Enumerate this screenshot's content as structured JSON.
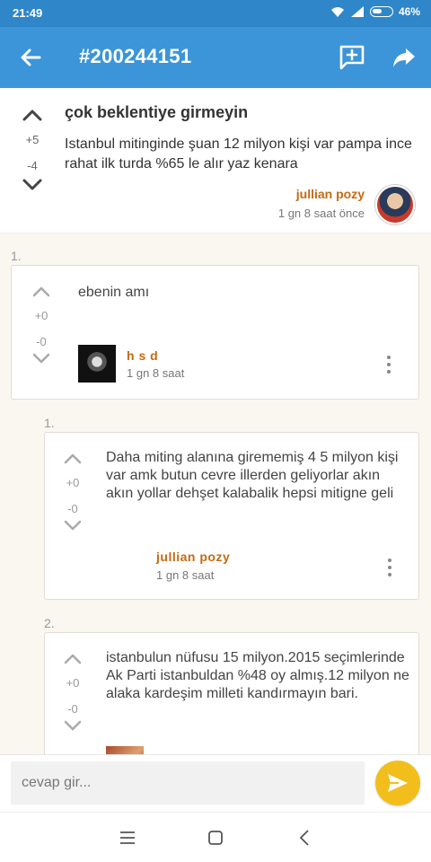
{
  "status": {
    "time": "21:49",
    "battery": "46%"
  },
  "appbar": {
    "title": "#200244151"
  },
  "entry": {
    "title": "çok beklentiye girmeyin",
    "body": "Istanbul mitinginde şuan 12 milyon kişi var pampa ince rahat ilk turda %65 le alır yaz kenara",
    "up": "+5",
    "down": "-4",
    "author": "jullian pozy",
    "meta": "1 gn 8 saat  önce"
  },
  "comments": [
    {
      "index": "1.",
      "up": "+0",
      "down": "-0",
      "text": "ebenin amı",
      "author": "h s d",
      "time": "1 gn 8 saat"
    },
    {
      "index": "1.",
      "up": "+0",
      "down": "-0",
      "text": "Daha miting alanına girememiş 4 5 milyon kişi var amk butun cevre illerden geliyorlar akın akın yollar dehşet kalabalik hepsi mitigne geli",
      "author": "jullian pozy",
      "time": "1 gn 8 saat"
    },
    {
      "index": "2.",
      "up": "+0",
      "down": "-0",
      "text": "istanbulun nüfusu 15 milyon.2015 seçimlerinde Ak Parti istanbuldan %48 oy almış.12 milyon ne alaka kardeşim milleti kandırmayın bari."
    }
  ],
  "reply": {
    "placeholder": "cevap gir..."
  },
  "colors": {
    "appbar": "#3b95d8",
    "statusbar": "#2f86c8",
    "author": "#c46a12",
    "send": "#f2be1c"
  }
}
